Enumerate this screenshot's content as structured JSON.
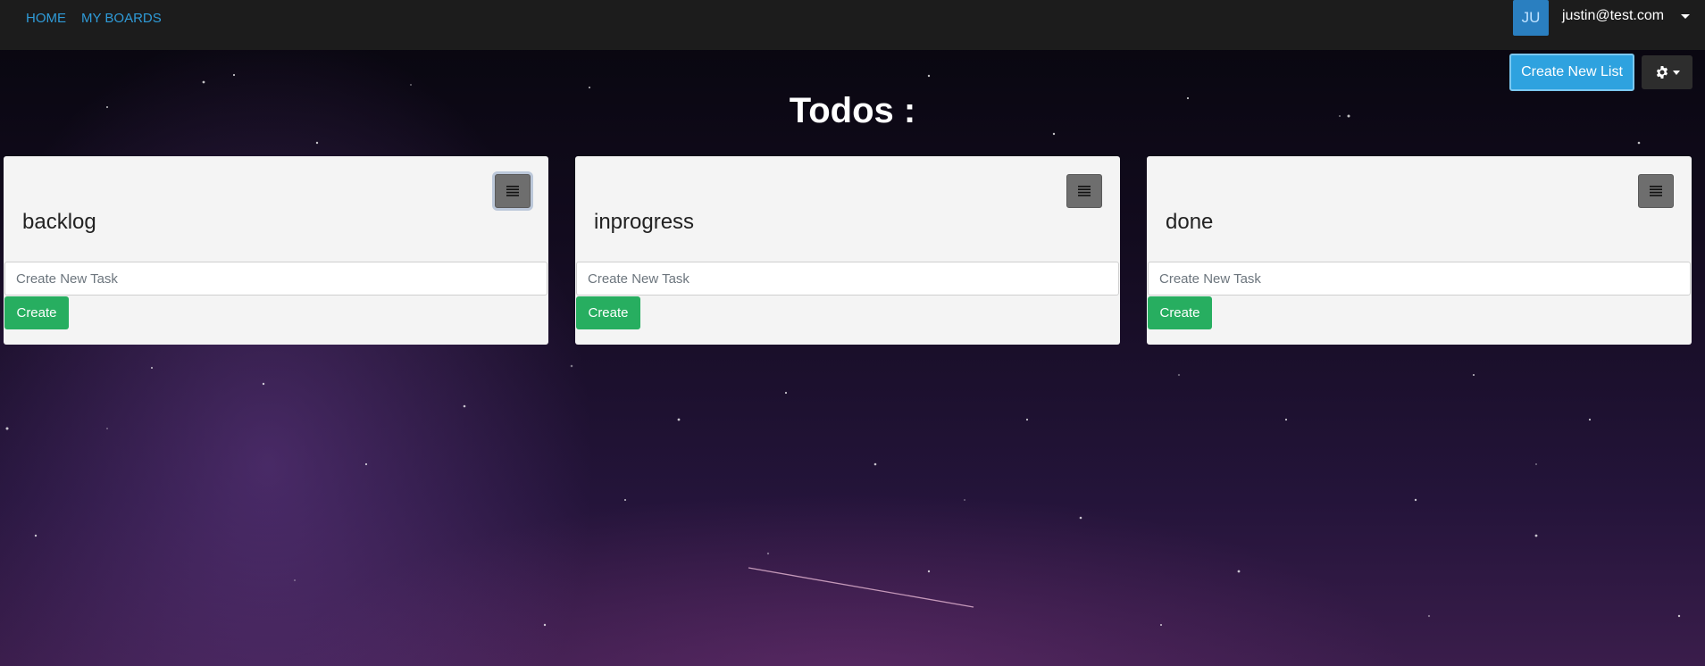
{
  "nav": {
    "home": "HOME",
    "my_boards": "MY BOARDS"
  },
  "user": {
    "initials": "JU",
    "email": "justin@test.com"
  },
  "toolbar": {
    "create_new_list": "Create New List",
    "settings_icon": "gear-icon"
  },
  "page_title": "Todos :",
  "lists": [
    {
      "title": "backlog",
      "input_placeholder": "Create New Task",
      "create_label": "Create"
    },
    {
      "title": "inprogress",
      "input_placeholder": "Create New Task",
      "create_label": "Create"
    },
    {
      "title": "done",
      "input_placeholder": "Create New Task",
      "create_label": "Create"
    }
  ],
  "colors": {
    "navbar": "#1c1c1c",
    "link": "#2f9bd8",
    "primary_button": "#2ea2df",
    "create_button": "#27ae60",
    "card": "#f4f4f4"
  }
}
